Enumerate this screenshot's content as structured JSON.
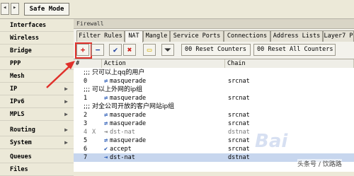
{
  "topbar": {
    "back_icon": "back-arrow-icon",
    "forward_icon": "forward-arrow-icon",
    "safe_mode_label": "Safe Mode"
  },
  "sidebar": {
    "items": [
      {
        "label": "Interfaces",
        "submenu": false
      },
      {
        "label": "Wireless",
        "submenu": false
      },
      {
        "label": "Bridge",
        "submenu": false
      },
      {
        "label": "PPP",
        "submenu": false
      },
      {
        "label": "Mesh",
        "submenu": false
      },
      {
        "label": "IP",
        "submenu": true
      },
      {
        "label": "IPv6",
        "submenu": true
      },
      {
        "label": "MPLS",
        "submenu": true
      },
      {
        "label": "Routing",
        "submenu": true
      },
      {
        "label": "System",
        "submenu": true
      },
      {
        "label": "Queues",
        "submenu": false
      },
      {
        "label": "Files",
        "submenu": false
      }
    ]
  },
  "window": {
    "title": "Firewall",
    "tabs": [
      "Filter Rules",
      "NAT",
      "Mangle",
      "Service Ports",
      "Connections",
      "Address Lists",
      "Layer7 P"
    ],
    "active_tab": "NAT"
  },
  "toolbar": {
    "add_icon": "plus-icon",
    "remove_icon": "minus-icon",
    "enable_icon": "check-icon",
    "disable_icon": "x-icon",
    "comment_icon": "comment-icon",
    "filter_icon": "filter-icon",
    "reset_counters": "00 Reset Counters",
    "reset_all_counters": "00 Reset All Counters"
  },
  "table": {
    "headers": {
      "num": "#",
      "action": "Action",
      "chain": "Chain"
    },
    "rows": [
      {
        "type": "comment",
        "text": ";;; 只可以上qq的用户"
      },
      {
        "type": "rule",
        "num": "0",
        "flag": "",
        "icon": "masquerade-icon",
        "action": "masquerade",
        "chain": "srcnat"
      },
      {
        "type": "comment",
        "text": ";;; 可以上外网的ip组"
      },
      {
        "type": "rule",
        "num": "1",
        "flag": "",
        "icon": "masquerade-icon",
        "action": "masquerade",
        "chain": "srcnat"
      },
      {
        "type": "comment",
        "text": ";;; 对全公司开放的客户网站ip组"
      },
      {
        "type": "rule",
        "num": "2",
        "flag": "",
        "icon": "masquerade-icon",
        "action": "masquerade",
        "chain": "srcnat"
      },
      {
        "type": "rule",
        "num": "3",
        "flag": "",
        "icon": "masquerade-icon",
        "action": "masquerade",
        "chain": "srcnat"
      },
      {
        "type": "rule",
        "num": "4",
        "flag": "X",
        "icon": "dst-nat-icon",
        "action": "dst-nat",
        "chain": "dstnat"
      },
      {
        "type": "rule",
        "num": "5",
        "flag": "",
        "icon": "masquerade-icon",
        "action": "masquerade",
        "chain": "srcnat"
      },
      {
        "type": "rule",
        "num": "6",
        "flag": "",
        "icon": "accept-icon",
        "action": "accept",
        "chain": "srcnat"
      },
      {
        "type": "rule",
        "num": "7",
        "flag": "",
        "icon": "dst-nat-icon",
        "action": "dst-nat",
        "chain": "dstnat",
        "selected": true
      }
    ]
  },
  "annotation": {
    "color": "#E0302A"
  },
  "watermark": {
    "text": "Bai",
    "sub": "头条号 / 饮路路"
  }
}
